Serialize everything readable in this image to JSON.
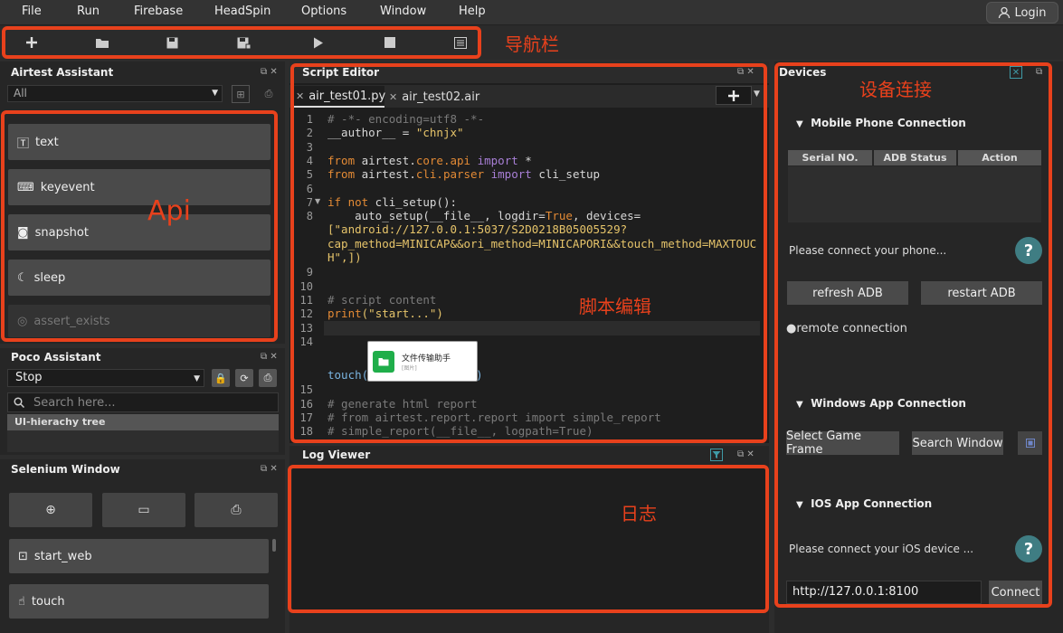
{
  "menu": [
    "File",
    "Run",
    "Firebase",
    "HeadSpin",
    "Options",
    "Window",
    "Help"
  ],
  "login_label": "Login",
  "annotations": {
    "toolbar": "导航栏",
    "api": "Api",
    "editor": "脚本编辑",
    "log": "日志",
    "devices": "设备连接"
  },
  "airtest_assistant": {
    "title": "Airtest Assistant",
    "filter_value": "All",
    "items": [
      "text",
      "keyevent",
      "snapshot",
      "sleep",
      "assert_exists"
    ]
  },
  "poco_assistant": {
    "title": "Poco Assistant",
    "mode_value": "Stop",
    "search_placeholder": "Search here...",
    "tree_label": "UI-hierachy tree"
  },
  "selenium_window": {
    "title": "Selenium Window",
    "items": [
      "start_web",
      "touch"
    ]
  },
  "script_editor": {
    "title": "Script Editor",
    "tabs": [
      "air_test01.py",
      "air_test02.air"
    ],
    "line_numbers": [
      "1",
      "2",
      "3",
      "4",
      "5",
      "6",
      "7",
      "8",
      "9",
      "10",
      "11",
      "12",
      "13",
      "14",
      "15",
      "16",
      "17",
      "18"
    ],
    "code": {
      "l1": "# -*- encoding=utf8 -*-",
      "l2a": "__author__ = ",
      "l2b": "\"chnjx\"",
      "l4a": "from",
      "l4b": " airtest.",
      "l4c": "core.api",
      "l4d": " import",
      "l4e": " *",
      "l5a": "from",
      "l5b": " airtest.",
      "l5c": "cli.parser",
      "l5d": " import",
      "l5e": " cli_setup",
      "l7a": "if not",
      "l7b": " cli_setup():",
      "l8a": "    auto_setup(__file__, logdir=",
      "l8b": "True",
      "l8c": ", devices=",
      "l8d": "[\"android://127.0.0.1:5037/S2D0218B05005529?",
      "l8e": "cap_method=MINICAP&&ori_method=MINICAPORI&&touch_method=MAXTOUC",
      "l8f": "H\",])",
      "l11": "# script content",
      "l12a": "print",
      "l12b": "(\"start...\")",
      "l14a": "touch(",
      "l14b": ")",
      "l16": "# generate html report",
      "l17": "# from airtest.report.report import simple_report",
      "l18": "# simple_report(__file__, logpath=True)"
    },
    "image_title": "文件传输助手",
    "image_sub": "[图片]"
  },
  "log_viewer": {
    "title": "Log Viewer"
  },
  "devices": {
    "title": "Devices",
    "mobile_section": "Mobile Phone Connection",
    "table_headers": [
      "Serial NO.",
      "ADB Status",
      "Action"
    ],
    "connect_prompt": "Please connect your phone...",
    "refresh_label": "refresh ADB",
    "restart_label": "restart ADB",
    "remote_label": "remote connection",
    "windows_section": "Windows App Connection",
    "select_frame_label": "Select Game Frame",
    "search_window_label": "Search Window",
    "ios_section": "IOS App Connection",
    "ios_prompt": "Please connect your iOS device ...",
    "ios_url": "http://127.0.0.1:8100",
    "connect_label": "Connect"
  },
  "colors": {
    "annotation": "#e8411c",
    "help": "#3f7d83",
    "button": "#4a4a4a"
  }
}
